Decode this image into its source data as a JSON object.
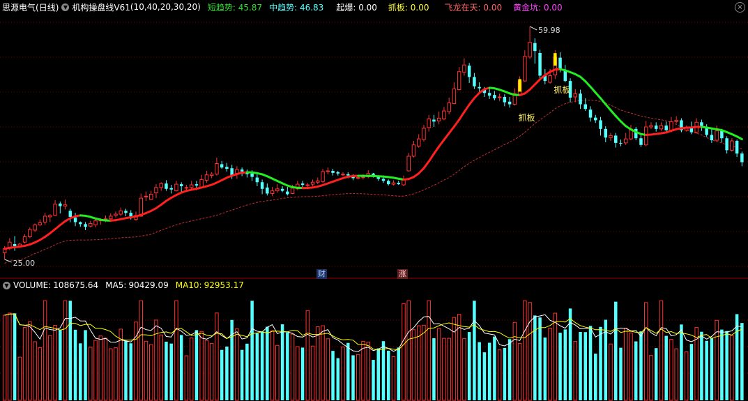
{
  "header": {
    "stock_name": "思源电气",
    "period": "(日线)",
    "indicator_name": "机构操盘线V61",
    "indicator_params": "(10,40,20,30,20)",
    "items": [
      {
        "label": "短趋势:",
        "value": "45.87",
        "color": "#33dd33"
      },
      {
        "label": "中趋势:",
        "value": "46.83",
        "color": "#55ffff"
      },
      {
        "label": "起爆:",
        "value": "0.00",
        "color": "#ffffff"
      },
      {
        "label": "抓板:",
        "value": "0.00",
        "color": "#ffff33"
      },
      {
        "label": "飞龙在天:",
        "value": "0.00",
        "color": "#ff6666"
      },
      {
        "label": "黄金坑:",
        "value": "0.00",
        "color": "#ff44ff"
      }
    ],
    "close_icon": "close-icon"
  },
  "volume_header": {
    "label": "VOLUME:",
    "value": "108675.64",
    "ma5_label": "MA5:",
    "ma5_value": "90429.09",
    "ma10_label": "MA10:",
    "ma10_value": "92953.17"
  },
  "markers": {
    "high_label": "59.98",
    "low_label": "25.00",
    "signal_label_1": "抓板",
    "signal_label_2": "抓板",
    "badge_cai": "财",
    "badge_zhang": "涨"
  },
  "colors": {
    "up": "#ff3232",
    "down": "#54ffff",
    "trend_up": "#ff2020",
    "trend_down": "#22ee22",
    "ma_dashed": "#c03030",
    "vol_up": "#ff3232",
    "vol_down": "#54ffff",
    "ma5_line": "#ffffff",
    "ma10_line": "#ffff00",
    "grid": "#7a0000"
  },
  "chart_data": {
    "type": "candlestick",
    "title": "思源电气 (日线)",
    "price_range": [
      25.0,
      59.98
    ],
    "candles": [
      [
        26.0,
        26.6,
        25.0,
        27.0
      ],
      [
        26.7,
        27.6,
        26.4,
        28.2
      ],
      [
        27.3,
        27.0,
        26.3,
        28.5
      ],
      [
        27.0,
        27.3,
        26.9,
        27.5
      ],
      [
        27.6,
        28.4,
        27.4,
        28.8
      ],
      [
        28.4,
        29.5,
        28.2,
        29.8
      ],
      [
        29.4,
        30.2,
        29.1,
        30.4
      ],
      [
        30.2,
        30.5,
        30.0,
        31.0
      ],
      [
        30.6,
        31.5,
        30.2,
        32.0
      ],
      [
        31.4,
        31.6,
        30.6,
        31.8
      ],
      [
        31.6,
        33.3,
        31.5,
        33.9
      ],
      [
        33.4,
        33.0,
        31.9,
        33.7
      ],
      [
        33.0,
        33.2,
        32.5,
        34.0
      ],
      [
        32.3,
        31.4,
        30.6,
        32.6
      ],
      [
        31.3,
        30.6,
        30.0,
        32.0
      ],
      [
        30.6,
        30.3,
        29.9,
        30.7
      ],
      [
        30.3,
        29.9,
        29.4,
        30.6
      ],
      [
        30.0,
        30.4,
        29.8,
        30.8
      ],
      [
        30.2,
        30.8,
        29.8,
        31.2
      ],
      [
        30.8,
        30.9,
        30.2,
        31.2
      ],
      [
        31.0,
        31.1,
        30.6,
        31.6
      ],
      [
        31.1,
        31.5,
        30.8,
        31.9
      ],
      [
        31.6,
        31.8,
        31.3,
        32.2
      ],
      [
        31.8,
        32.3,
        31.5,
        32.8
      ],
      [
        32.3,
        32.0,
        31.5,
        32.6
      ],
      [
        32.0,
        31.4,
        31.0,
        32.4
      ],
      [
        31.0,
        31.6,
        30.8,
        32.2
      ],
      [
        31.5,
        34.2,
        31.4,
        34.9
      ],
      [
        34.5,
        34.5,
        33.8,
        35.2
      ],
      [
        34.0,
        34.8,
        33.9,
        35.3
      ],
      [
        35.0,
        35.8,
        34.2,
        36.3
      ],
      [
        35.8,
        36.4,
        35.3,
        36.6
      ],
      [
        36.4,
        35.6,
        35.3,
        36.9
      ],
      [
        35.7,
        35.5,
        34.9,
        36.2
      ],
      [
        35.3,
        36.3,
        35.2,
        36.8
      ],
      [
        36.3,
        36.0,
        35.1,
        36.6
      ],
      [
        35.8,
        35.8,
        35.3,
        36.2
      ],
      [
        35.8,
        36.2,
        35.4,
        36.8
      ],
      [
        36.3,
        36.1,
        35.4,
        36.8
      ],
      [
        35.8,
        37.0,
        35.7,
        37.7
      ],
      [
        36.9,
        37.7,
        36.5,
        38.3
      ],
      [
        37.6,
        37.8,
        37.2,
        38.1
      ],
      [
        37.8,
        39.4,
        37.6,
        40.3
      ],
      [
        39.3,
        38.8,
        38.6,
        39.8
      ],
      [
        38.9,
        38.6,
        38.2,
        39.5
      ],
      [
        38.7,
        37.6,
        37.1,
        39.2
      ],
      [
        37.9,
        38.5,
        37.1,
        39.0
      ],
      [
        38.5,
        38.2,
        37.5,
        38.8
      ],
      [
        38.0,
        37.8,
        37.3,
        38.5
      ],
      [
        37.9,
        37.4,
        36.8,
        38.4
      ],
      [
        37.3,
        36.6,
        36.0,
        37.8
      ],
      [
        36.6,
        35.6,
        34.8,
        37.0
      ],
      [
        35.8,
        34.9,
        34.6,
        36.4
      ],
      [
        34.9,
        35.3,
        34.5,
        35.9
      ],
      [
        35.3,
        35.6,
        35.0,
        36.3
      ],
      [
        35.6,
        35.3,
        35.1,
        36.0
      ],
      [
        35.2,
        34.8,
        34.6,
        35.9
      ],
      [
        34.9,
        35.7,
        34.8,
        36.2
      ],
      [
        35.6,
        36.3,
        35.4,
        36.8
      ],
      [
        36.4,
        36.2,
        35.8,
        36.8
      ],
      [
        36.2,
        36.2,
        35.9,
        36.5
      ],
      [
        36.3,
        36.6,
        36.0,
        37.0
      ],
      [
        36.6,
        36.8,
        36.3,
        37.3
      ],
      [
        36.7,
        38.2,
        36.5,
        38.6
      ],
      [
        38.2,
        38.3,
        37.8,
        38.8
      ],
      [
        38.3,
        38.0,
        37.6,
        38.6
      ],
      [
        38.1,
        37.9,
        37.6,
        38.3
      ],
      [
        37.8,
        37.8,
        37.5,
        38.1
      ],
      [
        37.8,
        37.6,
        37.2,
        38.1
      ],
      [
        37.6,
        37.2,
        36.9,
        37.8
      ],
      [
        37.2,
        37.3,
        37.0,
        37.7
      ],
      [
        37.3,
        37.4,
        37.0,
        37.8
      ],
      [
        37.4,
        37.9,
        37.2,
        38.4
      ],
      [
        37.9,
        37.5,
        37.3,
        38.0
      ],
      [
        37.5,
        37.1,
        36.8,
        37.6
      ],
      [
        37.1,
        36.8,
        36.5,
        37.3
      ],
      [
        36.8,
        36.3,
        36.1,
        37.0
      ],
      [
        36.3,
        36.5,
        36.1,
        36.9
      ],
      [
        36.5,
        36.3,
        36.2,
        36.8
      ],
      [
        36.2,
        37.1,
        36.0,
        37.6
      ],
      [
        38.3,
        40.5,
        38.2,
        41.0
      ],
      [
        40.5,
        42.2,
        40.3,
        42.8
      ],
      [
        42.0,
        43.1,
        41.8,
        43.8
      ],
      [
        43.0,
        44.7,
        42.7,
        45.2
      ],
      [
        44.8,
        46.1,
        44.2,
        46.7
      ],
      [
        46.0,
        45.7,
        44.9,
        46.7
      ],
      [
        45.8,
        46.2,
        45.3,
        47.2
      ],
      [
        46.1,
        47.3,
        45.9,
        47.9
      ],
      [
        47.2,
        48.5,
        46.8,
        49.3
      ],
      [
        48.4,
        50.6,
        48.3,
        51.6
      ],
      [
        50.5,
        53.2,
        50.4,
        53.9
      ],
      [
        53.1,
        54.2,
        52.6,
        55.2
      ],
      [
        54.1,
        52.4,
        51.5,
        54.5
      ],
      [
        52.4,
        51.0,
        50.6,
        53.0
      ],
      [
        50.9,
        50.7,
        50.2,
        51.6
      ],
      [
        50.5,
        50.0,
        49.4,
        50.9
      ],
      [
        50.0,
        49.6,
        49.1,
        50.8
      ],
      [
        49.7,
        49.2,
        48.9,
        50.3
      ],
      [
        49.3,
        49.4,
        48.8,
        49.9
      ],
      [
        49.4,
        48.6,
        48.0,
        49.8
      ],
      [
        48.7,
        48.3,
        47.8,
        49.4
      ],
      [
        48.3,
        49.9,
        48.1,
        50.7
      ],
      [
        49.8,
        51.8,
        49.6,
        52.5
      ],
      [
        51.8,
        55.5,
        51.7,
        56.4
      ],
      [
        55.4,
        57.6,
        55.1,
        59.98
      ],
      [
        57.5,
        56.3,
        54.4,
        58.2
      ],
      [
        56.0,
        52.6,
        52.1,
        56.5
      ],
      [
        52.6,
        51.8,
        51.3,
        53.6
      ],
      [
        51.6,
        52.6,
        51.4,
        53.6
      ],
      [
        52.7,
        55.4,
        52.1,
        56.4
      ],
      [
        55.3,
        53.6,
        53.1,
        56.1
      ],
      [
        53.5,
        51.8,
        51.6,
        54.2
      ],
      [
        51.8,
        49.3,
        48.6,
        52.2
      ],
      [
        49.4,
        49.9,
        48.6,
        50.6
      ],
      [
        49.9,
        48.3,
        47.6,
        50.5
      ],
      [
        48.3,
        47.6,
        47.3,
        49.2
      ],
      [
        47.5,
        46.3,
        45.7,
        48.0
      ],
      [
        46.3,
        45.9,
        45.5,
        46.7
      ],
      [
        45.9,
        44.6,
        43.6,
        46.4
      ],
      [
        44.6,
        43.3,
        42.6,
        45.0
      ],
      [
        43.3,
        43.6,
        42.8,
        44.0
      ],
      [
        43.6,
        42.5,
        41.8,
        44.0
      ],
      [
        42.5,
        42.4,
        42.0,
        43.0
      ],
      [
        42.5,
        43.1,
        42.2,
        44.0
      ],
      [
        43.1,
        44.6,
        42.9,
        45.2
      ],
      [
        44.6,
        43.2,
        42.9,
        44.9
      ],
      [
        43.2,
        42.2,
        41.9,
        43.7
      ],
      [
        42.2,
        44.9,
        42.0,
        45.8
      ],
      [
        44.9,
        45.1,
        44.6,
        45.6
      ],
      [
        45.1,
        44.6,
        44.2,
        45.6
      ],
      [
        44.6,
        45.1,
        44.3,
        45.6
      ],
      [
        45.1,
        44.4,
        44.0,
        45.7
      ],
      [
        44.4,
        45.7,
        44.1,
        46.4
      ],
      [
        45.7,
        45.9,
        45.4,
        46.5
      ],
      [
        45.9,
        44.4,
        44.1,
        46.2
      ],
      [
        44.4,
        44.8,
        44.2,
        45.1
      ],
      [
        44.8,
        44.1,
        43.8,
        45.7
      ],
      [
        44.1,
        45.6,
        43.9,
        46.2
      ],
      [
        45.6,
        44.8,
        44.3,
        46.0
      ],
      [
        44.8,
        43.7,
        43.4,
        45.3
      ],
      [
        43.7,
        42.9,
        42.5,
        44.6
      ],
      [
        42.9,
        44.3,
        42.6,
        45.1
      ],
      [
        44.3,
        43.2,
        42.6,
        44.6
      ],
      [
        43.2,
        41.4,
        40.9,
        43.5
      ],
      [
        41.4,
        42.8,
        41.2,
        43.2
      ],
      [
        42.8,
        40.9,
        40.4,
        43.0
      ],
      [
        40.9,
        39.6,
        39.0,
        41.2
      ]
    ],
    "volume_range": [
      0,
      150000
    ],
    "volume": {
      "last": 108675.64,
      "ma5": 90429.09,
      "ma10": 92953.17
    },
    "series": [
      {
        "name": "短趋势",
        "value": 45.87
      },
      {
        "name": "中趋势",
        "value": 46.83
      },
      {
        "name": "起爆",
        "value": 0.0
      },
      {
        "name": "抓板",
        "value": 0.0
      },
      {
        "name": "飞龙在天",
        "value": 0.0
      },
      {
        "name": "黄金坑",
        "value": 0.0
      }
    ],
    "annotations": [
      "59.98",
      "25.00",
      "抓板",
      "抓板",
      "财",
      "涨"
    ]
  }
}
